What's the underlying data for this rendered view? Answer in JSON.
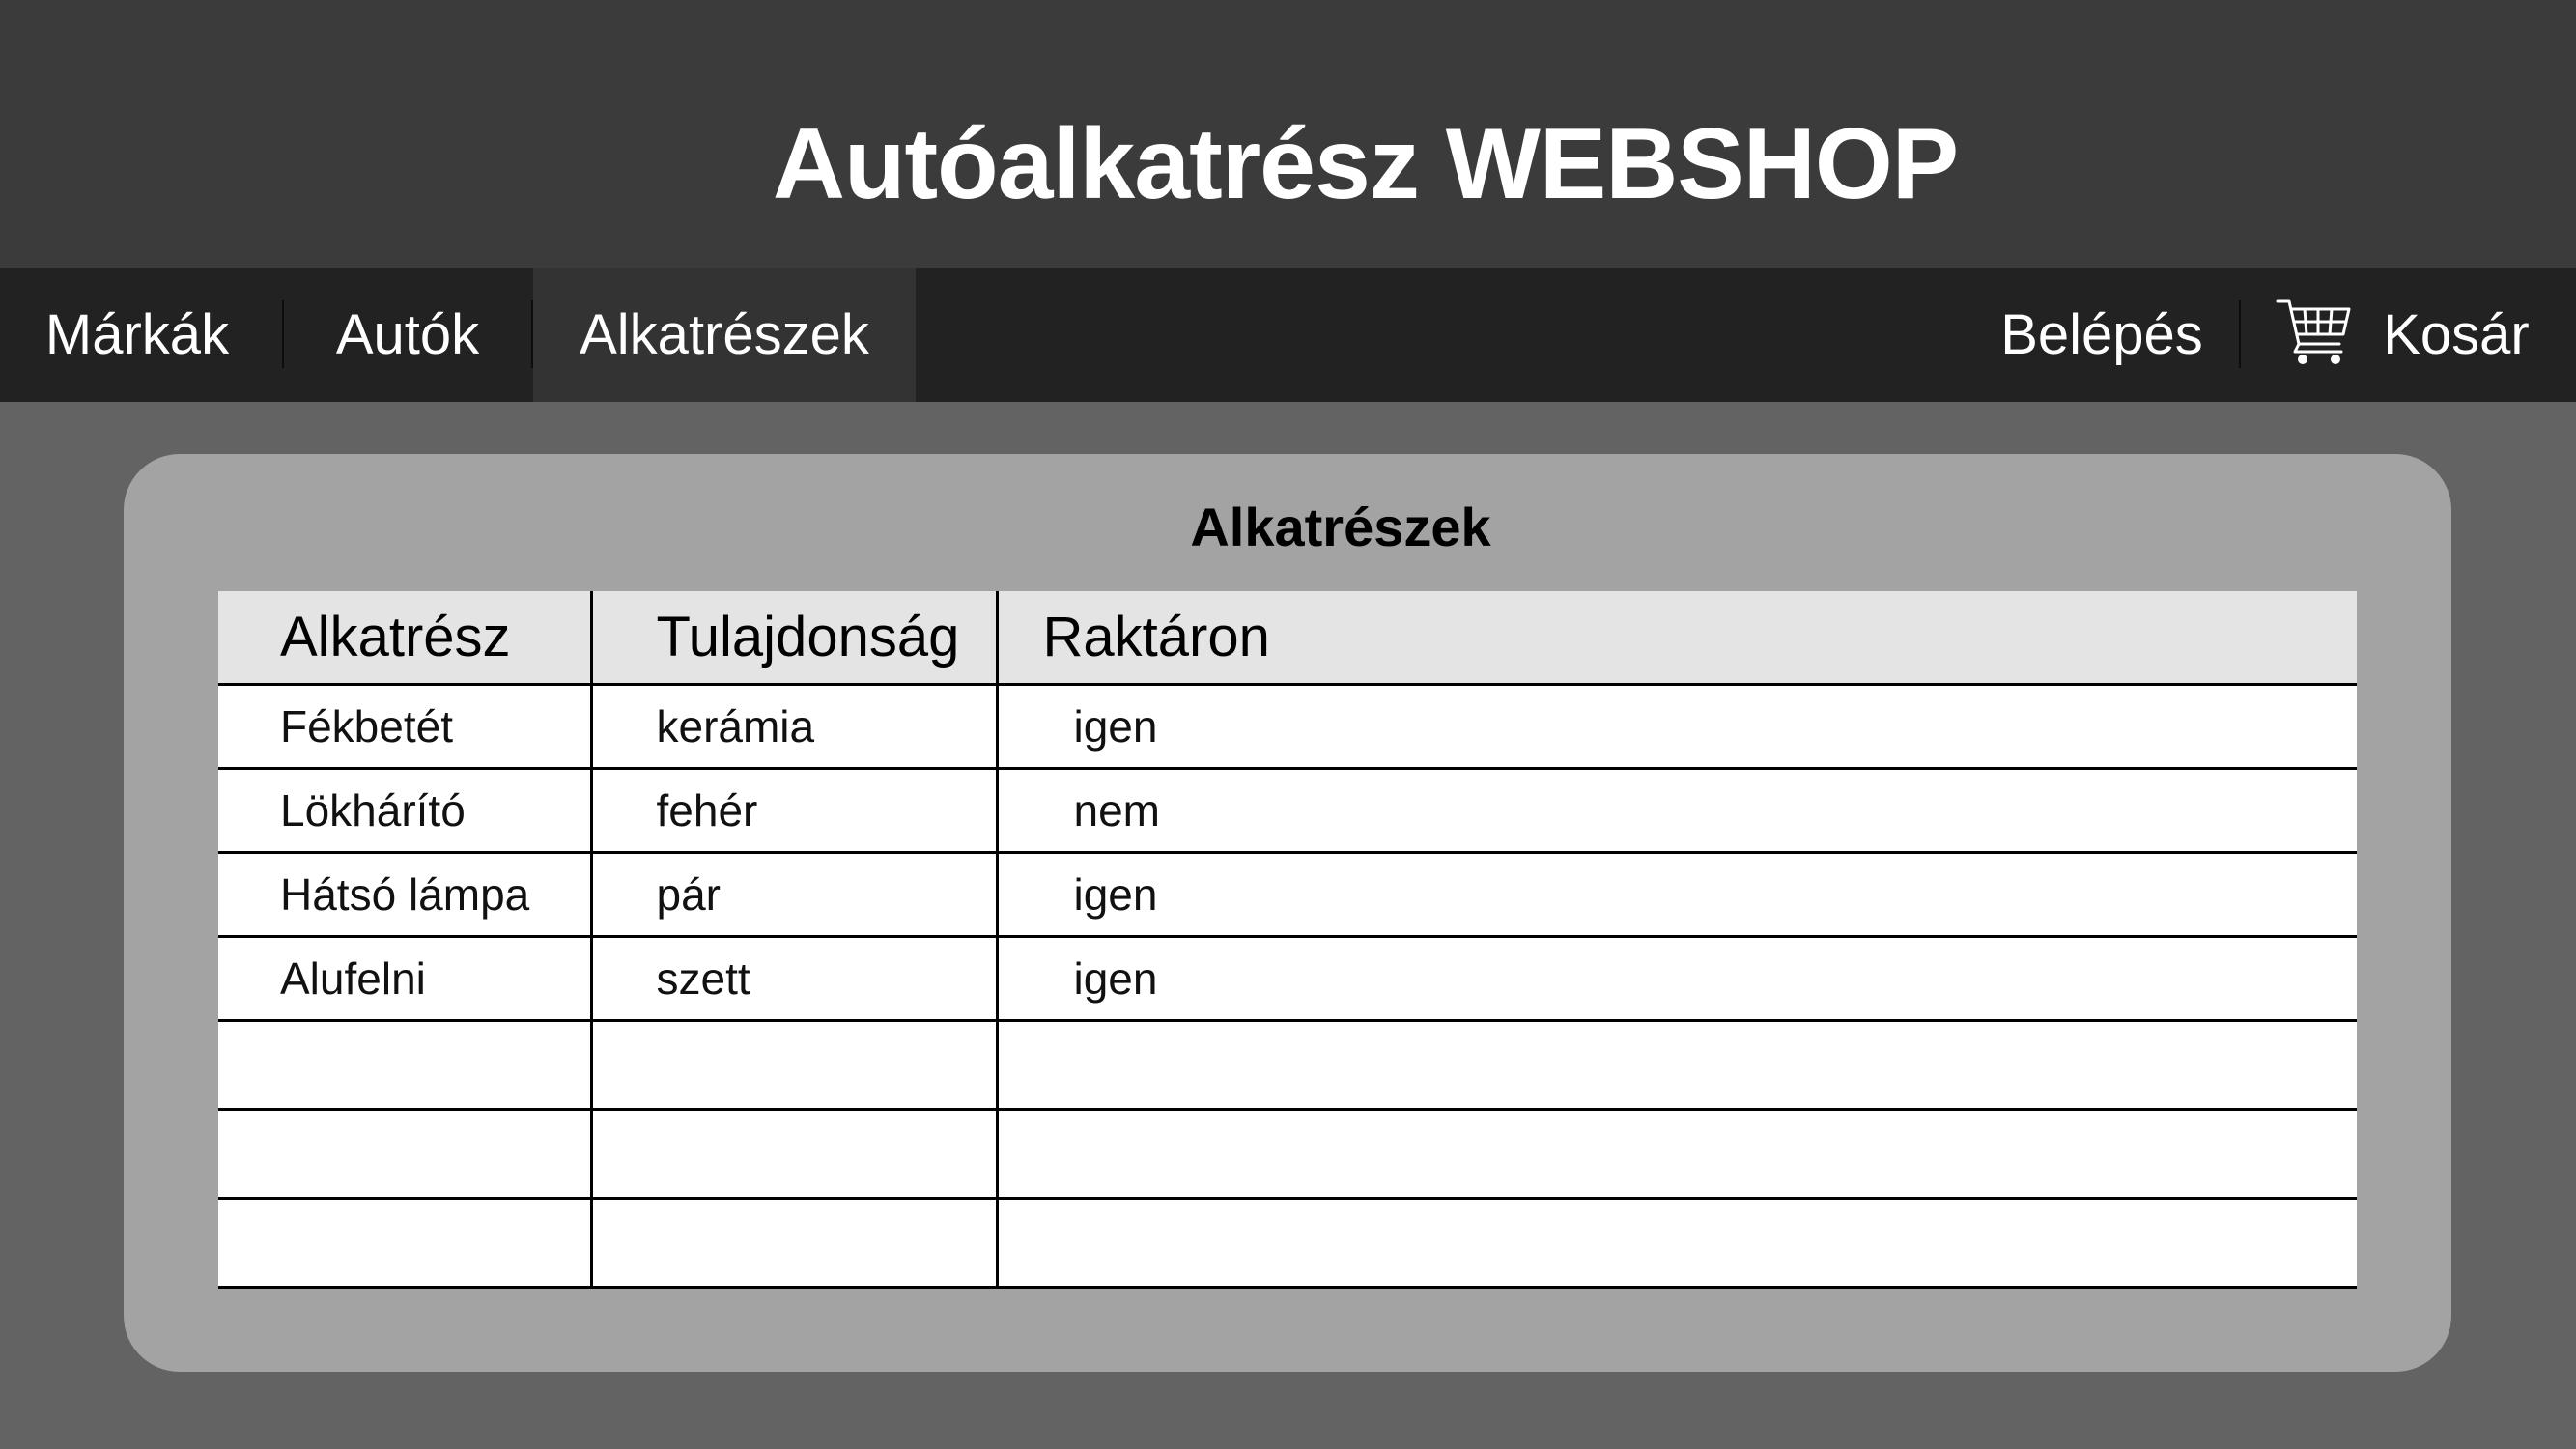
{
  "header": {
    "title": "Autóalkatrész WEBSHOP"
  },
  "nav": {
    "items": [
      {
        "label": "Márkák"
      },
      {
        "label": "Autók"
      },
      {
        "label": "Alkatrészek",
        "active": true
      }
    ],
    "login_label": "Belépés",
    "cart_label": "Kosár",
    "cart_icon": "shopping-cart-icon"
  },
  "panel": {
    "title": "Alkatrészek",
    "columns": [
      "Alkatrész",
      "Tulajdonság",
      "Raktáron"
    ],
    "rows": [
      [
        "Fékbetét",
        "kerámia",
        "igen"
      ],
      [
        "Lökhárító",
        "fehér",
        "nem"
      ],
      [
        "Hátsó lámpa",
        "pár",
        "igen"
      ],
      [
        "Alufelni",
        "szett",
        "igen"
      ]
    ],
    "empty_rows": 3
  },
  "colors": {
    "header_bg": "#3b3b3b",
    "nav_bg": "#222222",
    "nav_active_bg": "#333333",
    "page_bg": "#636363",
    "panel_bg": "#a3a3a3",
    "table_header_bg": "#e4e4e4"
  }
}
